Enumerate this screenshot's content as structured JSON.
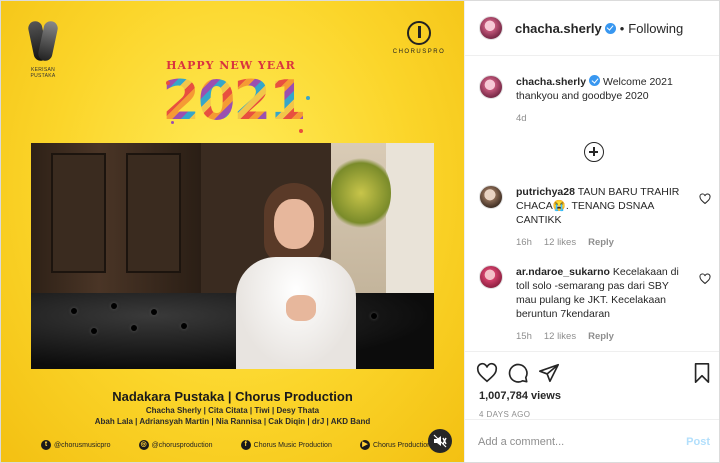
{
  "media": {
    "logo_left_caption": "KERISAN PUSTAKA",
    "logo_right_caption": "CHORUSPRO",
    "greeting": "HAPPY NEW YEAR",
    "year": "2021",
    "credit_title": "Nadakara Pustaka | Chorus Production",
    "credit_line1": "Chacha Sherly | Cita Citata | Tiwi | Desy Thata",
    "credit_line2": "Abah Lala | Adriansyah Martin | Nia Rannisa | Cak Diqin | drJ | AKD Band",
    "social": [
      {
        "icon": "twitter-icon",
        "glyph": "t",
        "label": "@chorusmusicpro"
      },
      {
        "icon": "instagram-icon",
        "glyph": "◎",
        "label": "@chorusproduction"
      },
      {
        "icon": "facebook-icon",
        "glyph": "f",
        "label": "Chorus Music Production"
      },
      {
        "icon": "youtube-icon",
        "glyph": "▶",
        "label": "Chorus Production"
      }
    ]
  },
  "post": {
    "username": "chacha.sherly",
    "separator": "•",
    "follow_status": "Following",
    "caption": {
      "username": "chacha.sherly",
      "text": "Welcome 2021 thankyou and goodbye 2020",
      "age": "4d"
    },
    "comments": [
      {
        "username": "putrichya28",
        "text": "TAUN BARU TRAHIR CHACA😭. TENANG DSNAA CANTIKK",
        "age": "16h",
        "likes": "12 likes",
        "reply": "Reply"
      },
      {
        "username": "ar.ndaroe_sukarno",
        "text": "Kecelakaan di toll solo -semarang pas dari SBY mau pulang ke JKT. Kecelakaan beruntun 7kendaran",
        "age": "15h",
        "likes": "12 likes",
        "reply": "Reply"
      }
    ],
    "views": "1,007,784 views",
    "posted": "4 DAYS AGO",
    "add_comment_placeholder": "Add a comment...",
    "post_button": "Post"
  },
  "colors": {
    "accent": "#3897f0",
    "background_yellow": "#fbd52a"
  }
}
